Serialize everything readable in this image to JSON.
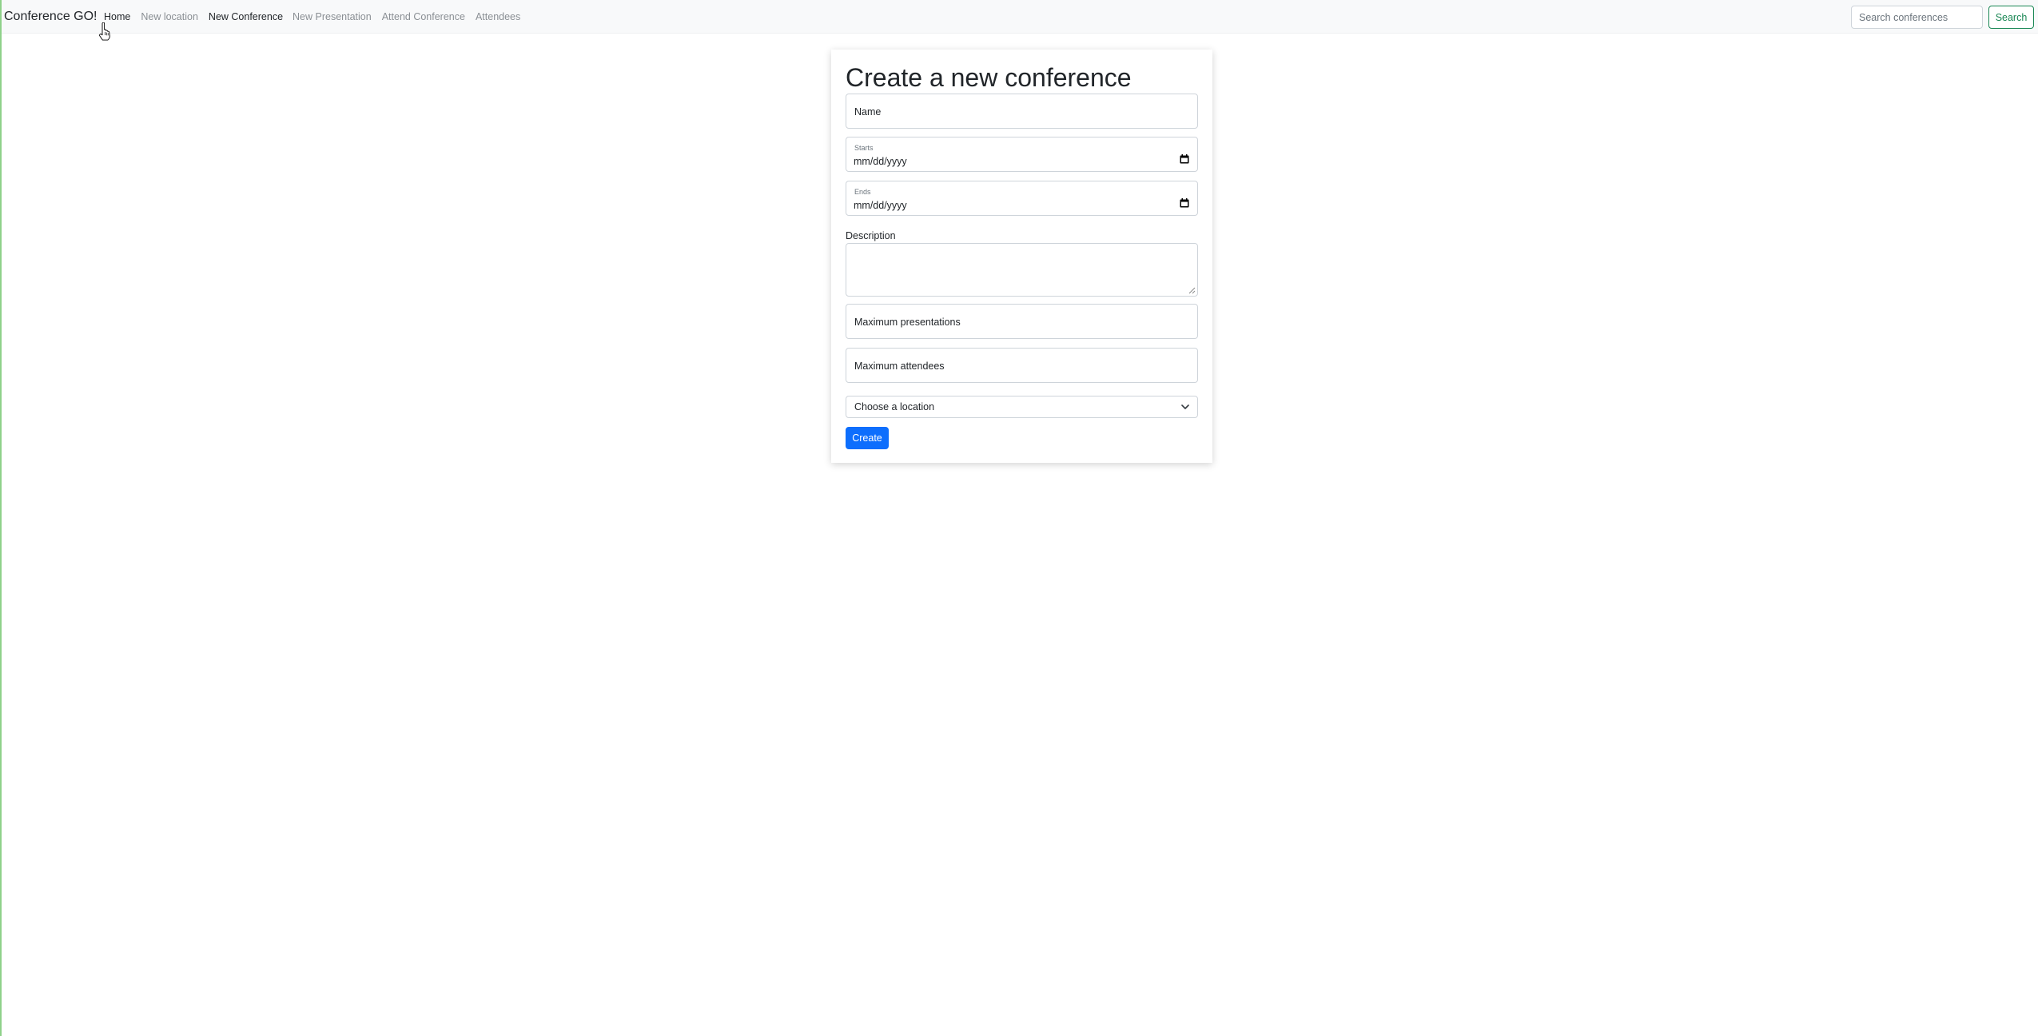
{
  "nav": {
    "brand": "Conference GO!",
    "links": {
      "home": "Home",
      "new_location": "New location",
      "new_conference": "New Conference",
      "new_presentation": "New Presentation",
      "attend_conference": "Attend Conference",
      "attendees": "Attendees"
    },
    "active": "new_conference",
    "search": {
      "placeholder": "Search conferences",
      "button": "Search"
    }
  },
  "form": {
    "title": "Create a new conference",
    "name_placeholder": "Name",
    "starts": {
      "label": "Starts",
      "value": "mm/dd/yyyy"
    },
    "ends": {
      "label": "Ends",
      "value": "mm/dd/yyyy"
    },
    "description_label": "Description",
    "max_presentations_placeholder": "Maximum presentations",
    "max_attendees_placeholder": "Maximum attendees",
    "location_select": "Choose a location",
    "submit": "Create"
  },
  "colors": {
    "primary": "#0d6efd",
    "success": "#198754",
    "navbar_bg": "#f8f9fa"
  },
  "icons": [
    "calendar-icon",
    "chevron-down-icon",
    "resize-handle-icon",
    "hand-pointer-cursor-icon"
  ]
}
